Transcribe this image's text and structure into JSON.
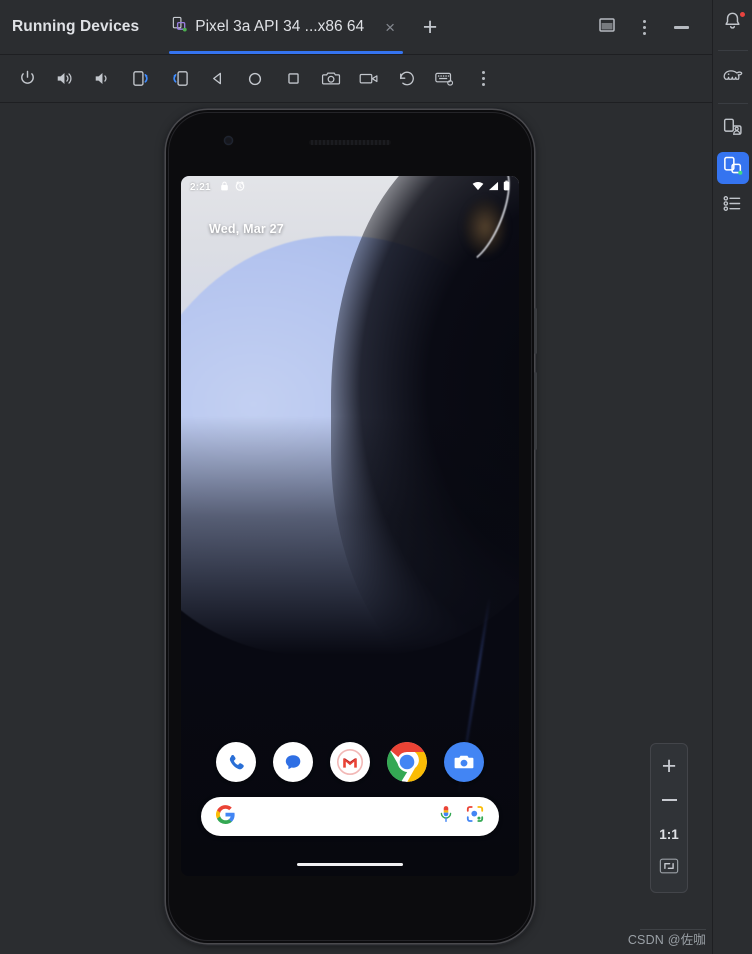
{
  "window": {
    "tool_title": "Running Devices",
    "tabs": [
      {
        "label": "Pixel 3a API 34 ...x86 64",
        "icon": "device-phone-icon",
        "running": true,
        "active": true,
        "close_label": "×"
      }
    ],
    "new_tab_label": "+",
    "controls": [
      {
        "name": "split-window-button",
        "icon": "split-window-icon"
      },
      {
        "name": "more-options-button",
        "icon": "vertical-dots-icon"
      },
      {
        "name": "minimize-button",
        "icon": "minimize-icon"
      }
    ],
    "accent_color": "#3574F0",
    "background_color": "#2B2D30"
  },
  "emulator_toolbar": {
    "buttons": [
      {
        "name": "power-button",
        "icon": "power-icon",
        "tooltip": "Power"
      },
      {
        "name": "volume-up-button",
        "icon": "volume-up-icon",
        "tooltip": "Volume Up"
      },
      {
        "name": "volume-down-button",
        "icon": "volume-down-icon",
        "tooltip": "Volume Down"
      },
      {
        "name": "rotate-left-button",
        "icon": "rotate-left-icon",
        "tooltip": "Rotate Left"
      },
      {
        "name": "rotate-right-button",
        "icon": "rotate-right-icon",
        "tooltip": "Rotate Right"
      },
      {
        "name": "back-button",
        "icon": "back-triangle-icon",
        "tooltip": "Back"
      },
      {
        "name": "home-button",
        "icon": "home-circle-icon",
        "tooltip": "Home"
      },
      {
        "name": "overview-button",
        "icon": "overview-square-icon",
        "tooltip": "Overview"
      },
      {
        "name": "screenshot-button",
        "icon": "camera-icon",
        "tooltip": "Take Screenshot"
      },
      {
        "name": "record-button",
        "icon": "video-camera-icon",
        "tooltip": "Record Screen"
      },
      {
        "name": "snapshot-button",
        "icon": "history-rotate-icon",
        "tooltip": "Snapshots"
      },
      {
        "name": "hardware-input-button",
        "icon": "keyboard-icon",
        "tooltip": "Hardware Input"
      },
      {
        "name": "toolbar-more-button",
        "icon": "vertical-dots-icon",
        "tooltip": "More"
      }
    ]
  },
  "device": {
    "model": "Pixel 3a",
    "screen": {
      "status_bar": {
        "time": "2:21",
        "left_icons": [
          "lock-icon",
          "alarm-clock-icon"
        ],
        "right_icons": [
          "wifi-icon",
          "signal-bars-icon",
          "battery-icon"
        ]
      },
      "date_widget": "Wed, Mar 27",
      "dock_apps": [
        {
          "name": "phone-app-icon",
          "label": "Phone"
        },
        {
          "name": "messages-app-icon",
          "label": "Messages"
        },
        {
          "name": "gmail-app-icon",
          "label": "Gmail"
        },
        {
          "name": "chrome-app-icon",
          "label": "Chrome"
        },
        {
          "name": "camera-app-icon",
          "label": "Camera"
        }
      ],
      "search_bar": {
        "placeholder": "",
        "value": "",
        "leading_icon": "google-g-icon",
        "trailing_icons": [
          "microphone-icon",
          "google-lens-icon"
        ]
      },
      "gesture_bar": true
    }
  },
  "zoom_panel": {
    "zoom_in_label": "+",
    "zoom_out_label": "−",
    "actual_size_label": "1:1",
    "fit_label": "fit-to-screen-icon"
  },
  "right_rail": {
    "items": [
      {
        "name": "notifications-button",
        "icon": "bell-icon",
        "badge": true,
        "active": false
      },
      {
        "name": "gradle-button",
        "icon": "gradle-elephant-icon",
        "badge": false,
        "active": false
      },
      {
        "name": "device-manager-button",
        "icon": "device-manager-icon",
        "badge": false,
        "active": false
      },
      {
        "name": "running-devices-button",
        "icon": "running-devices-icon",
        "badge": false,
        "active": true
      },
      {
        "name": "device-explorer-button",
        "icon": "bullet-list-icon",
        "badge": false,
        "active": false
      }
    ]
  },
  "watermark": {
    "text": "CSDN @佐咖"
  }
}
